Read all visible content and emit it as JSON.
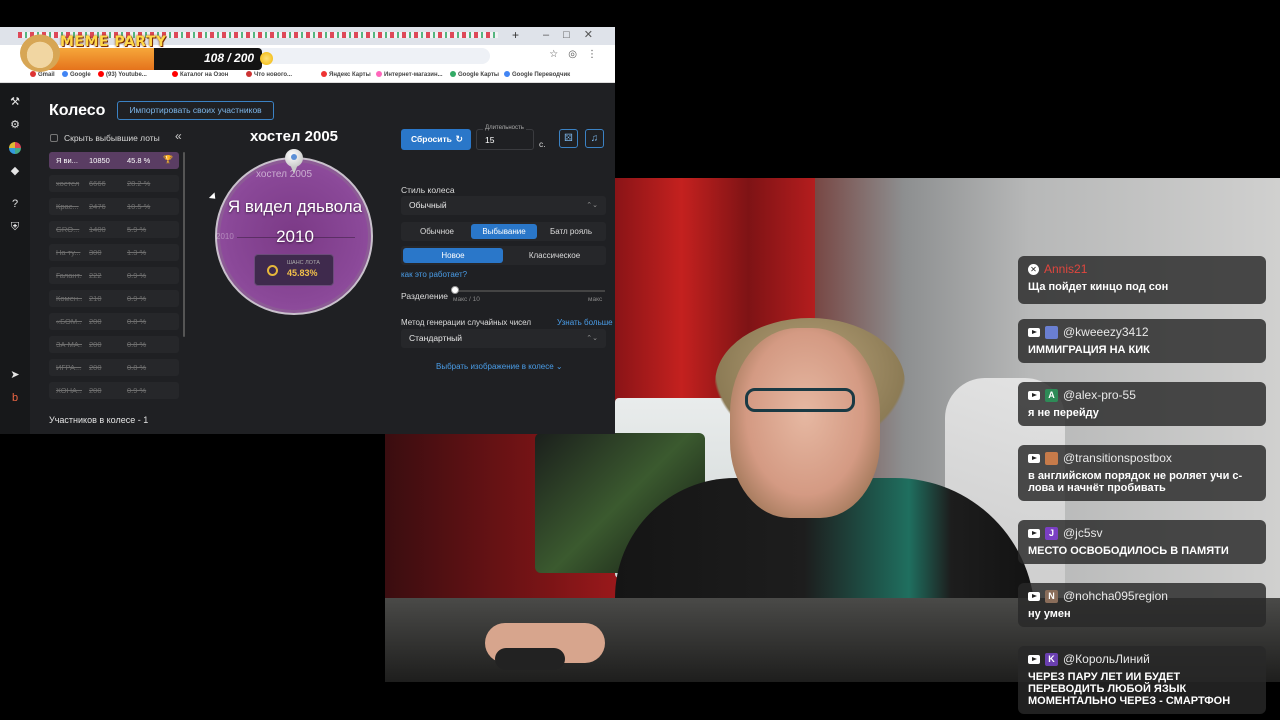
{
  "meme_party": {
    "title": "MEME PARTY",
    "count": "108 / 200"
  },
  "app": {
    "title": "Колесо",
    "import_button": "Импортировать своих участников",
    "hide_dropped_label": "Скрыть выбывшие лоты",
    "collapse_glyph": "«",
    "lots": [
      {
        "name": "Я ви...",
        "amount": "10850",
        "percent": "45.8 %",
        "active": true
      },
      {
        "name": "хостел",
        "amount": "6666",
        "percent": "28.2 %"
      },
      {
        "name": "Крас...",
        "amount": "2476",
        "percent": "10.5 %"
      },
      {
        "name": "GRO...",
        "amount": "1400",
        "percent": "5.9 %"
      },
      {
        "name": "На ту...",
        "amount": "300",
        "percent": "1.3 %"
      },
      {
        "name": "Галант...",
        "amount": "222",
        "percent": "0.9 %"
      },
      {
        "name": "Комен...",
        "amount": "210",
        "percent": "0.9 %"
      },
      {
        "name": "«БОМ...",
        "amount": "200",
        "percent": "0.8 %"
      },
      {
        "name": "ЗА МА...",
        "amount": "200",
        "percent": "0.8 %"
      },
      {
        "name": "ИГРА...",
        "amount": "200",
        "percent": "0.8 %"
      },
      {
        "name": "ХОНА...",
        "amount": "200",
        "percent": "0.9 %"
      }
    ],
    "participants_label": "Участников в колесе - 1",
    "wheel": {
      "title": "хостел 2005",
      "ghost_label": "хостел 2005",
      "ghost_label_left": "2010",
      "winner_line1": "Я видел дяьвола",
      "winner_line2": "2010",
      "chance_label": "ШАНС ЛОТА",
      "chance_value": "45.83%"
    },
    "controls": {
      "reset_button": "Сбросить",
      "duration_label": "Длительность",
      "duration_value": "15",
      "duration_unit": "с.",
      "style_label": "Стиль колеса",
      "style_value": "Обычный",
      "mode_options": [
        "Обычное",
        "Выбывание",
        "Батл рояль"
      ],
      "mode_selected": "Выбывание",
      "sub_options": [
        "Новое",
        "Классическое"
      ],
      "sub_selected": "Новое",
      "how_link": "как это работает?",
      "split_label": "Разделение",
      "split_min": "макс / 10",
      "split_max": "макс",
      "rng_label": "Метод генерации случайных чисел",
      "rng_link": "Узнать больше",
      "rng_value": "Стандартный",
      "choose_image": "Выбрать изображение в колесе"
    }
  },
  "bookmarks": [
    "Gmail",
    "Google",
    "(93) Youtube...",
    "Каталог на Озон",
    "Что нового...",
    "Яндекс Карты",
    "Интернет-магазин...",
    "Google Карты",
    "Google Переводчик"
  ],
  "chat": [
    {
      "user": "Annis21",
      "highlight": true,
      "avatar_color": "#d33",
      "text": "Ща пойдет кинцо под сон"
    },
    {
      "user": "@kweeezy3412",
      "avatar_color": "#6a7fd1",
      "text": "ИММИГРАЦИЯ НА КИК"
    },
    {
      "user": "@alex-pro-55",
      "avatar_letter": "A",
      "avatar_color": "#2e8b57",
      "text": "я не перейду"
    },
    {
      "user": "@transitionspostbox",
      "avatar_color": "#c77b4a",
      "text": "в английском порядок не роляет учи с-лова и начнёт пробивать"
    },
    {
      "user": "@jc5sv",
      "avatar_letter": "J",
      "avatar_color": "#7b3fc4",
      "text": "МЕСТО ОСВОБОДИЛОСЬ В ПАМЯТИ"
    },
    {
      "user": "@nohcha095region",
      "avatar_letter": "N",
      "avatar_color": "#8a6d5a",
      "text": "ну умен"
    },
    {
      "user": "@КорольЛиний",
      "avatar_letter": "K",
      "avatar_color": "#6a3fb0",
      "text": "ЧЕРЕЗ ПАРУ ЛЕТ ИИ БУДЕТ ПЕРЕВОДИТЬ ЛЮБОЙ ЯЗЫК МОМЕНТАЛЬНО ЧЕРЕЗ - СМАРТФОН"
    }
  ]
}
